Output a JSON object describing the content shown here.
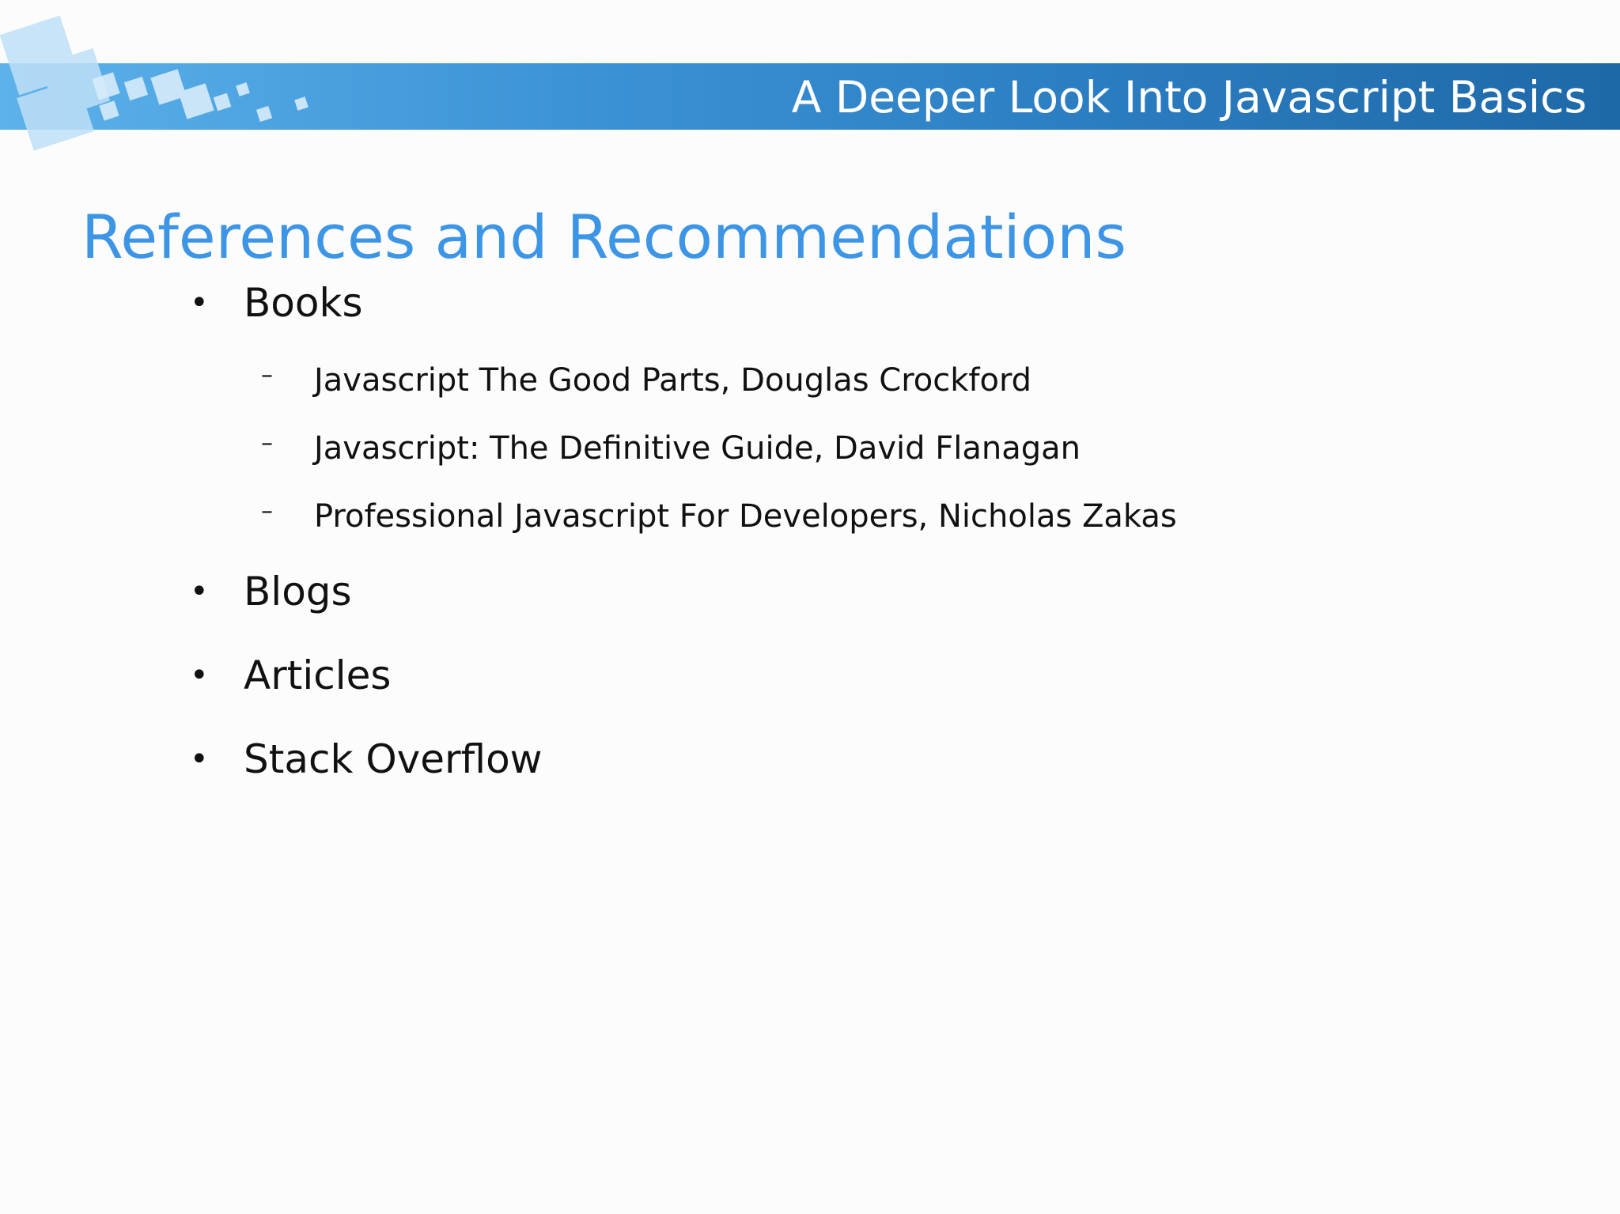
{
  "header": {
    "title": "A Deeper Look Into Javascript Basics"
  },
  "slide": {
    "title": "References and Recommendations",
    "bullet_glyph": "•",
    "dash_glyph": "–",
    "items": [
      {
        "label": "Books",
        "subitems": [
          "Javascript The Good Parts, Douglas Crockford",
          "Javascript: The Definitive Guide, David Flanagan",
          "Professional Javascript For Developers, Nicholas Zakas"
        ]
      },
      {
        "label": "Blogs"
      },
      {
        "label": "Articles"
      },
      {
        "label": "Stack Overflow"
      }
    ]
  },
  "colors": {
    "title_blue": "#3d95e6",
    "band_start": "#5db2ea",
    "band_end": "#1e68a7",
    "text": "#111111",
    "background": "#fcfcfc"
  }
}
